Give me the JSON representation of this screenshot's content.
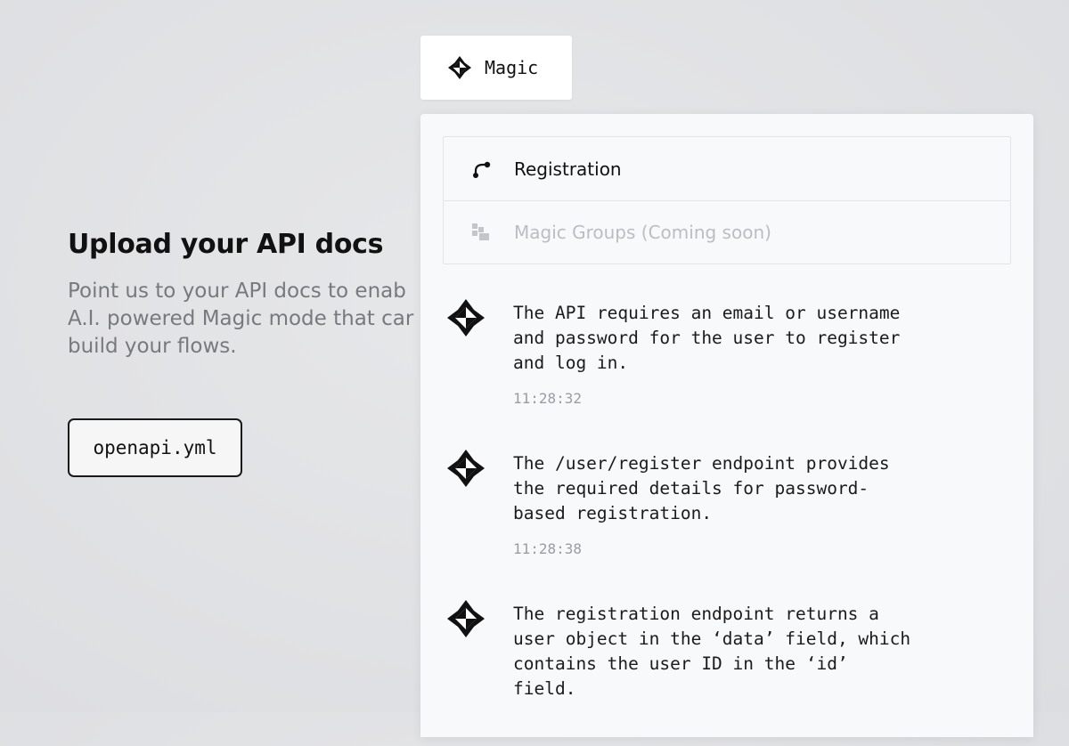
{
  "upload": {
    "title": "Upload your API docs",
    "description": "Point us to your API docs to enab\nA.I. powered Magic mode that car\nbuild your flows.",
    "file_name": "openapi.yml"
  },
  "magic_tab": {
    "label": "Magic",
    "icon": "magic-icon"
  },
  "menu": {
    "items": [
      {
        "label": "Registration",
        "icon": "flow-icon",
        "state": "active"
      },
      {
        "label": "Magic Groups (Coming soon)",
        "icon": "groups-icon",
        "state": "disabled"
      }
    ]
  },
  "messages": [
    {
      "text": "The API requires an email or username\nand password for the user to register\nand log in.",
      "time": "11:28:32",
      "icon": "magic-icon"
    },
    {
      "text": "The /user/register endpoint provides\nthe required details for password-\nbased registration.",
      "time": "11:28:38",
      "icon": "magic-icon"
    },
    {
      "text": "The registration endpoint returns a\nuser object in the ‘data’ field, which\ncontains the user ID in the ‘id’\nfield.",
      "icon": "magic-icon"
    }
  ],
  "colors": {
    "background": "#dfe0e2",
    "panel": "#f8f9fb",
    "text": "#111111",
    "muted": "#77797d",
    "disabled": "#bbbdc1",
    "timestamp": "#9a9ca0"
  }
}
